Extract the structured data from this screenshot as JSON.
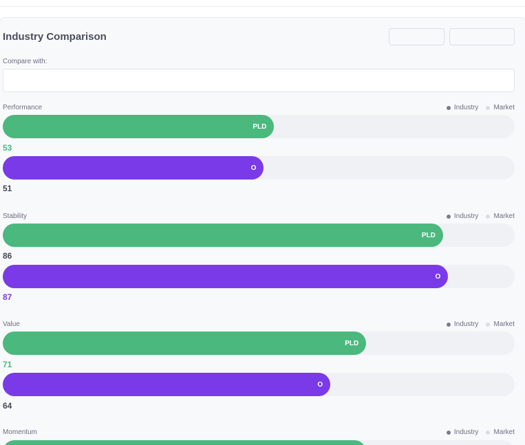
{
  "panel": {
    "title": "Industry Comparison",
    "compare_label": "Compare with:",
    "compare_value": ""
  },
  "legend": {
    "industry": "Industry",
    "market": "Market"
  },
  "colors": {
    "pld": "#4bb87e",
    "o": "#7a3ae8",
    "neutral_score": "#454a55"
  },
  "metrics": [
    {
      "name": "Performance",
      "bars": [
        {
          "ticker": "PLD",
          "value": 53,
          "score_text": "53",
          "highlight": true
        },
        {
          "ticker": "O",
          "value": 51,
          "score_text": "51",
          "highlight": false
        }
      ]
    },
    {
      "name": "Stability",
      "bars": [
        {
          "ticker": "PLD",
          "value": 86,
          "score_text": "86",
          "highlight": false
        },
        {
          "ticker": "O",
          "value": 87,
          "score_text": "87",
          "highlight": true
        }
      ]
    },
    {
      "name": "Value",
      "bars": [
        {
          "ticker": "PLD",
          "value": 71,
          "score_text": "71",
          "highlight": true
        },
        {
          "ticker": "O",
          "value": 64,
          "score_text": "64",
          "highlight": false
        }
      ]
    },
    {
      "name": "Momentum",
      "bars": [
        {
          "ticker": "PLD",
          "value": 71,
          "score_text": "",
          "highlight": false
        }
      ]
    }
  ]
}
